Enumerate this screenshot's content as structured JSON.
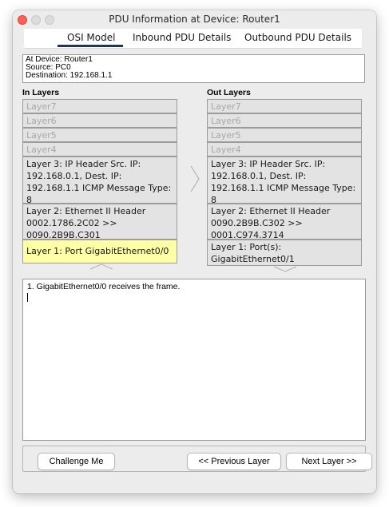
{
  "window": {
    "title": "PDU Information at Device: Router1"
  },
  "tabs": [
    {
      "label": "OSI Model",
      "selected": true
    },
    {
      "label": "Inbound PDU Details",
      "selected": false
    },
    {
      "label": "Outbound PDU Details",
      "selected": false
    }
  ],
  "info": {
    "device": "At Device: Router1",
    "source": "Source: PC0",
    "destination": "Destination: 192.168.1.1"
  },
  "in_layers": {
    "heading": "In Layers",
    "layers": [
      {
        "text": "Layer7"
      },
      {
        "text": "Layer6"
      },
      {
        "text": "Layer5"
      },
      {
        "text": "Layer4"
      },
      {
        "text": "Layer 3: IP Header Src. IP: 192.168.0.1, Dest. IP: 192.168.1.1 ICMP Message Type: 8"
      },
      {
        "text": "Layer 2: Ethernet II Header 0002.1786.2C02 >> 0090.2B9B.C301"
      },
      {
        "text": "Layer 1: Port GigabitEthernet0/0"
      }
    ]
  },
  "out_layers": {
    "heading": "Out Layers",
    "layers": [
      {
        "text": "Layer7"
      },
      {
        "text": "Layer6"
      },
      {
        "text": "Layer5"
      },
      {
        "text": "Layer4"
      },
      {
        "text": "Layer 3: IP Header Src. IP: 192.168.0.1, Dest. IP: 192.168.1.1 ICMP Message Type: 8"
      },
      {
        "text": "Layer 2: Ethernet II Header 0090.2B9B.C302 >> 0001.C974.3714"
      },
      {
        "text": "Layer 1: Port(s): GigabitEthernet0/1"
      }
    ]
  },
  "description": {
    "text": "1. GigabitEthernet0/0 receives the frame."
  },
  "buttons": {
    "challenge": "Challenge Me",
    "previous": "<< Previous Layer",
    "next": "Next Layer >>"
  },
  "colors": {
    "highlight": "#ffffa6",
    "layer_bg": "#e3e3e3",
    "tab_underline": "#1f3550",
    "close": "#ff5f57"
  }
}
